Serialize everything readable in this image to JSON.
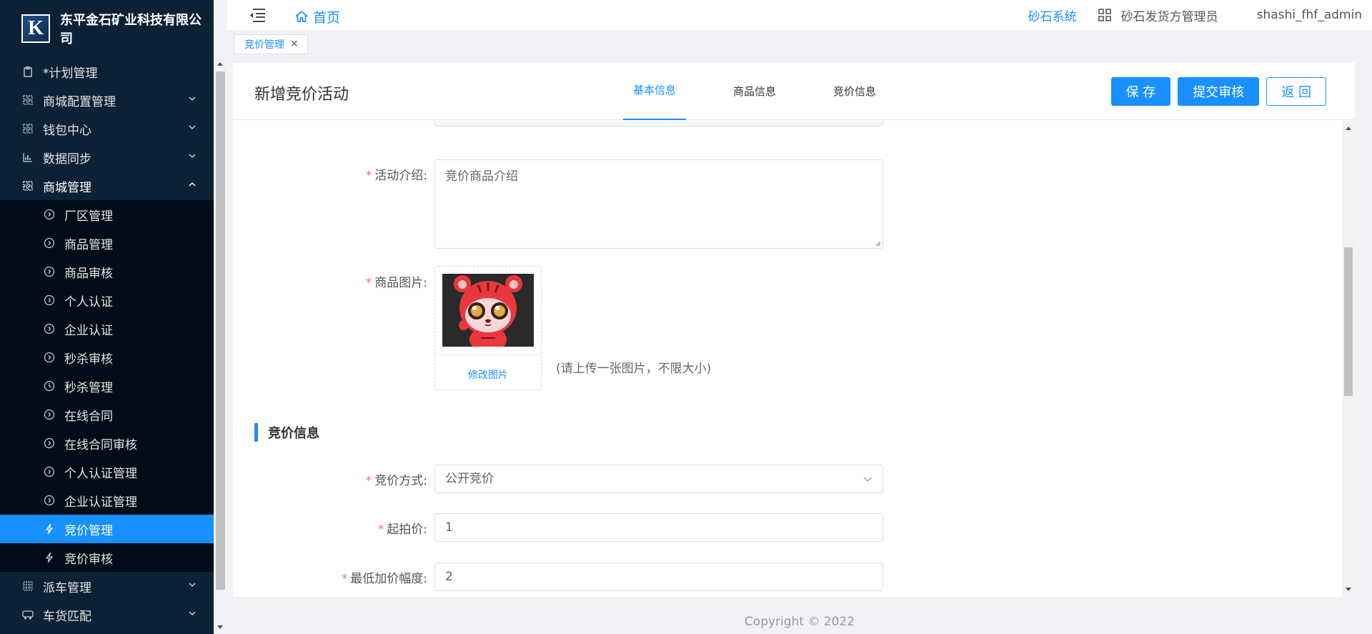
{
  "brand": {
    "title": "东平金石矿业科技有限公司",
    "logo_letter": "K"
  },
  "header": {
    "home_label": "首页",
    "system_label": "砂石系统",
    "role_label": "砂石发货方管理员",
    "username": "shashi_fhf_admin"
  },
  "tags": {
    "active_tag": "竞价管理"
  },
  "sidebar": {
    "items": [
      {
        "label": "*计划管理",
        "icon": "clipboard-icon"
      },
      {
        "label": "商城配置管理",
        "icon": "grid-icon"
      },
      {
        "label": "钱包中心",
        "icon": "grid-icon"
      },
      {
        "label": "数据同步",
        "icon": "bar-chart-icon"
      },
      {
        "label": "商城管理",
        "icon": "grid-icon"
      }
    ],
    "sub_items": [
      {
        "label": "厂区管理",
        "icon": "circle-arrow-icon"
      },
      {
        "label": "商品管理",
        "icon": "circle-arrow-icon"
      },
      {
        "label": "商品审核",
        "icon": "circle-arrow-icon"
      },
      {
        "label": "个人认证",
        "icon": "circle-arrow-icon"
      },
      {
        "label": "企业认证",
        "icon": "circle-arrow-icon"
      },
      {
        "label": "秒杀审核",
        "icon": "circle-arrow-icon"
      },
      {
        "label": "秒杀管理",
        "icon": "clock-icon"
      },
      {
        "label": "在线合同",
        "icon": "circle-arrow-icon"
      },
      {
        "label": "在线合同审核",
        "icon": "circle-arrow-icon"
      },
      {
        "label": "个人认证管理",
        "icon": "circle-arrow-icon"
      },
      {
        "label": "企业认证管理",
        "icon": "circle-arrow-icon"
      },
      {
        "label": "竞价管理",
        "icon": "lightning-icon"
      },
      {
        "label": "竞价审核",
        "icon": "lightning-icon"
      }
    ],
    "bottom_items": [
      {
        "label": "派车管理",
        "icon": "grid-icon"
      },
      {
        "label": "车货匹配",
        "icon": "truck-icon"
      }
    ]
  },
  "page": {
    "title": "新增竞价活动",
    "tabs": [
      "基本信息",
      "商品信息",
      "竞价信息"
    ],
    "buttons": {
      "save": "保 存",
      "submit": "提交审核",
      "back": "返 回"
    }
  },
  "form": {
    "intro_label": "活动介绍:",
    "intro_placeholder": "竞价商品介绍",
    "image_label": "商品图片:",
    "change_image": "修改图片",
    "image_hint": "(请上传一张图片，不限大小)",
    "section_title": "竞价信息",
    "method_label": "竞价方式:",
    "method_value": "公开竞价",
    "start_price_label": "起拍价:",
    "start_price_value": "1",
    "min_increment_label": "最低加价幅度:",
    "min_increment_value": "2"
  },
  "footer": {
    "copyright": "Copyright © 2022"
  },
  "colors": {
    "primary": "#1890ff",
    "sidebar_bg": "#0c2135",
    "submenu_bg": "#000c17",
    "required": "#f56c6c"
  }
}
